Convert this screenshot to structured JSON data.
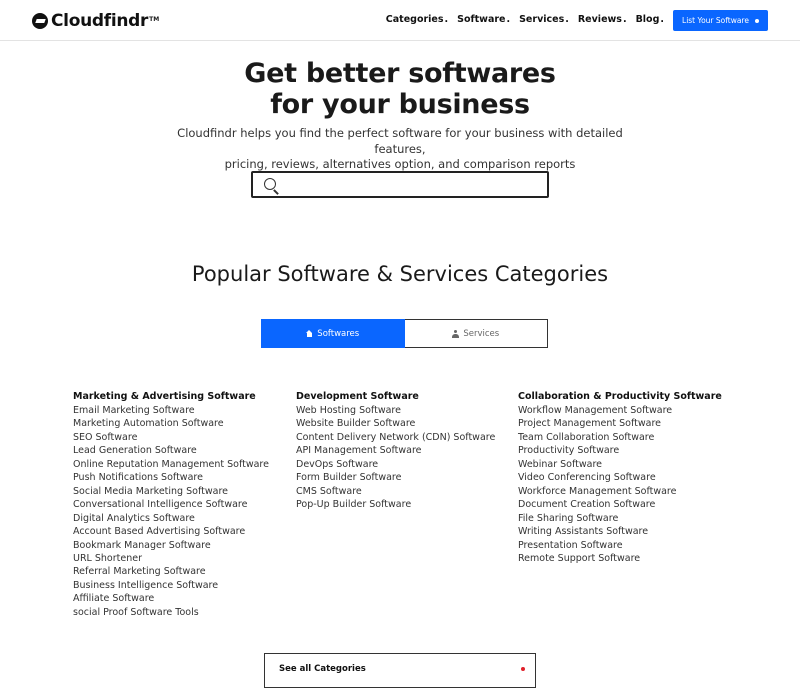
{
  "header": {
    "logo_text": "Cloudfindr",
    "logo_tm": "TM",
    "nav": [
      "Categories",
      "Software",
      "Services",
      "Reviews",
      "Blog"
    ],
    "cta_label": "List Your Software",
    "cta_color": "#0a66ff"
  },
  "hero": {
    "title_line1": "Get better softwares",
    "title_line2": "for your business",
    "subtitle_line1": "Cloudfindr helps you find the perfect software for your business with detailed features,",
    "subtitle_line2": "pricing, reviews, alternatives option, and comparison reports",
    "search_value": ""
  },
  "categories": {
    "title": "Popular Software & Services Categories",
    "tabs": {
      "softwares": "Softwares",
      "services": "Services"
    },
    "columns": [
      {
        "title": "Marketing & Advertising Software",
        "items": [
          "Email Marketing Software",
          "Marketing Automation Software",
          "SEO Software",
          "Lead Generation Software",
          "Online Reputation Management Software",
          "Push Notifications Software",
          "Social Media Marketing Software",
          "Conversational Intelligence Software",
          "Digital Analytics Software",
          "Account Based Advertising Software",
          "Bookmark Manager Software",
          "URL Shortener",
          "Referral Marketing Software",
          "Business Intelligence Software",
          "Affiliate Software",
          "social Proof Software Tools"
        ]
      },
      {
        "title": "Development Software",
        "items": [
          "Web Hosting Software",
          "Website Builder Software",
          "Content Delivery Network (CDN) Software",
          "API Management Software",
          "DevOps Software",
          "Form Builder Software",
          "CMS Software",
          "Pop-Up Builder Software"
        ]
      },
      {
        "title": "Collaboration & Productivity Software",
        "items": [
          "Workflow Management Software",
          "Project Management Software",
          "Team Collaboration Software",
          "Productivity Software",
          "Webinar Software",
          "Video Conferencing Software",
          "Workforce Management Software",
          "Document Creation Software",
          "File Sharing Software",
          "Writing Assistants Software",
          "Presentation Software",
          "Remote Support Software"
        ]
      }
    ],
    "see_all_label": "See all Categories"
  }
}
